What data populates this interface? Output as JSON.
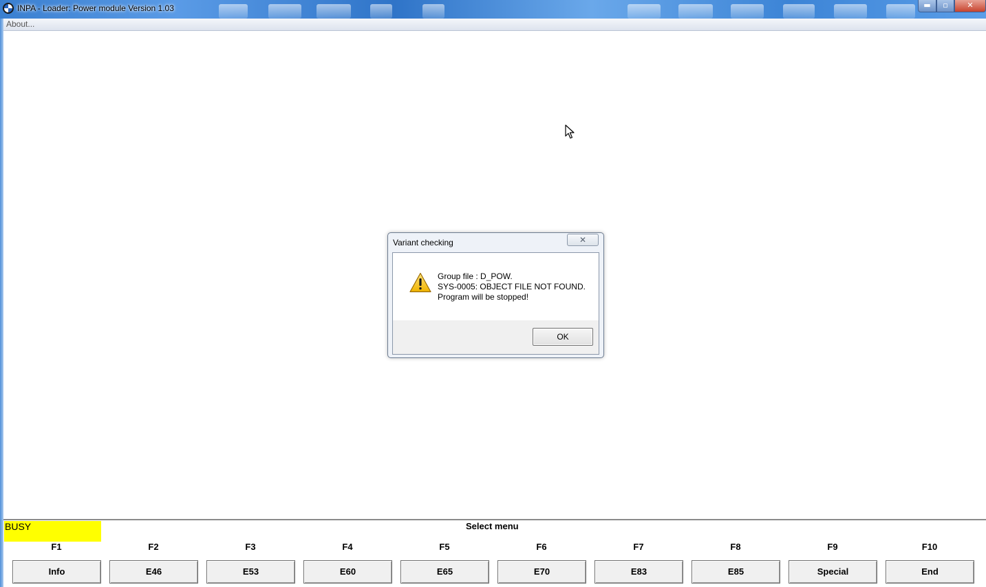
{
  "window": {
    "title": "INPA - Loader:  Power module Version 1.03",
    "minimize_glyph": "▬",
    "maximize_glyph": "▫",
    "close_glyph": "✕"
  },
  "menu": {
    "about": "About..."
  },
  "dialog": {
    "title": "Variant checking",
    "close_glyph": "✕",
    "icon": "warning-icon",
    "lines": [
      "Group file : D_POW.",
      "SYS-0005: OBJECT FILE NOT FOUND.",
      "Program will be stopped!"
    ],
    "ok_label": "OK"
  },
  "status": {
    "busy": "BUSY",
    "busy_color": "#ffff00",
    "select_menu": "Select menu"
  },
  "function_keys": [
    {
      "key": "F1",
      "label": "Info"
    },
    {
      "key": "F2",
      "label": "E46"
    },
    {
      "key": "F3",
      "label": "E53"
    },
    {
      "key": "F4",
      "label": "E60"
    },
    {
      "key": "F5",
      "label": "E65"
    },
    {
      "key": "F6",
      "label": "E70"
    },
    {
      "key": "F7",
      "label": "E83"
    },
    {
      "key": "F8",
      "label": "E85"
    },
    {
      "key": "F9",
      "label": "Special"
    },
    {
      "key": "F10",
      "label": "End"
    }
  ]
}
